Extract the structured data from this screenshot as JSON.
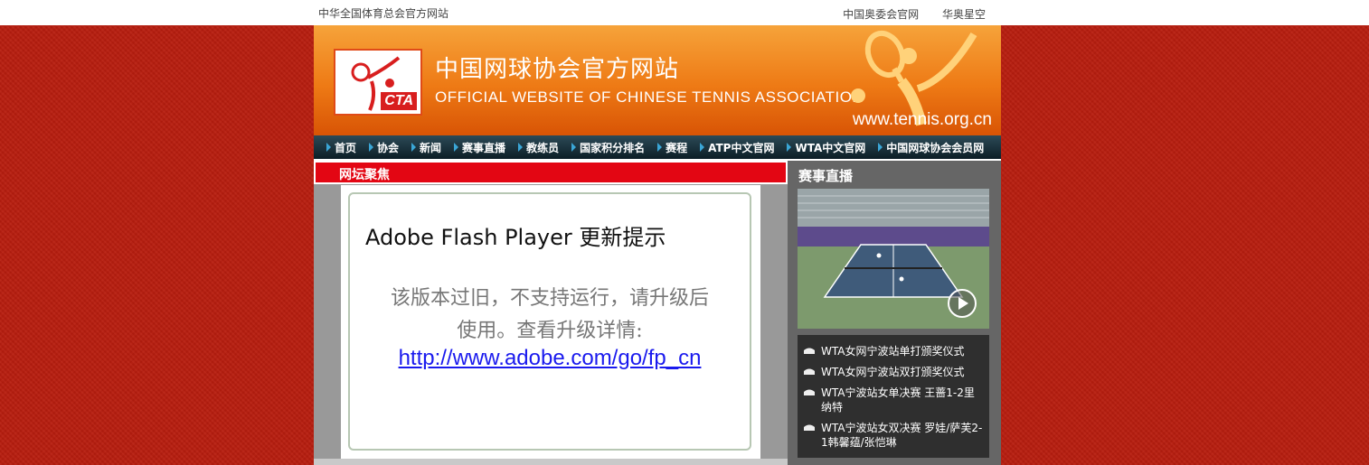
{
  "topbar": {
    "left_text": "中华全国体育总会官方网站",
    "links": [
      "中国奥委会官网",
      "华奥星空"
    ]
  },
  "banner": {
    "logo_text": "CTA",
    "cn_title": "中国网球协会官方网站",
    "en_title": "OFFICIAL WEBSITE OF CHINESE TENNIS ASSOCIATION",
    "url": "www.tennis.org.cn"
  },
  "nav": {
    "items": [
      "首页",
      "协会",
      "新闻",
      "赛事直播",
      "教练员",
      "国家积分排名",
      "赛程",
      "ATP中文官网",
      "WTA中文官网",
      "中国网球协会会员网"
    ]
  },
  "main": {
    "section_title": "网坛聚焦",
    "flash": {
      "title": "Adobe Flash Player 更新提示",
      "message_line1": "该版本过旧，不支持运行，请升级后",
      "message_line2": "使用。查看升级详情:",
      "link": "http://www.adobe.com/go/fp_cn"
    }
  },
  "sidebar": {
    "title": "赛事直播",
    "items": [
      "WTA女网宁波站单打颁奖仪式",
      "WTA女网宁波站双打颁奖仪式",
      "WTA宁波站女单决赛 王蔷1-2里纳特",
      "WTA宁波站女双决赛 罗娃/萨芙2-1韩馨蕴/张恺琳"
    ]
  },
  "colors": {
    "page_background": "#b81d0e",
    "banner_orange": "#ee7a15",
    "nav_dark": "#0c1e26",
    "section_red": "#e30613",
    "link_blue": "#1a1aee"
  }
}
